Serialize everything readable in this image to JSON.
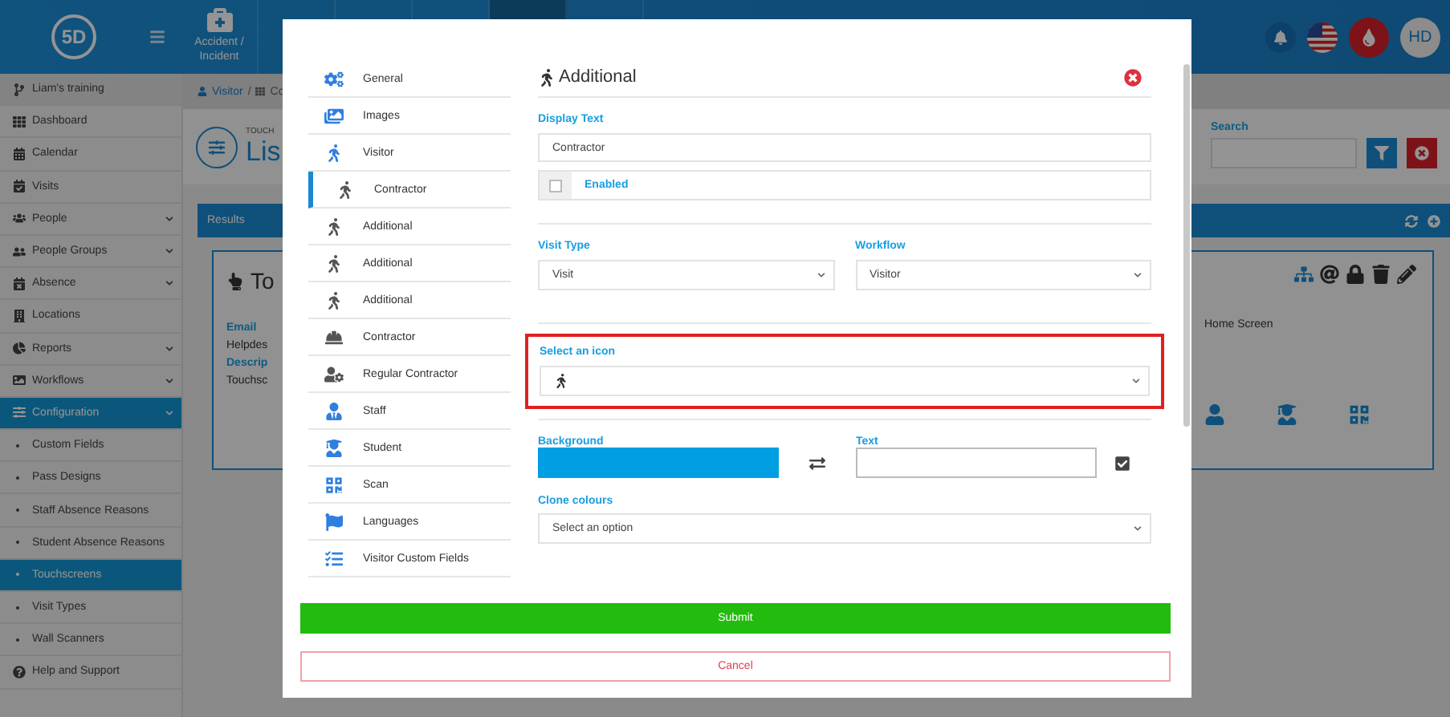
{
  "topbar": {
    "logo": "5D",
    "nav": [
      {
        "label": "Accident / Incident"
      }
    ],
    "avatar": "HD"
  },
  "sidebar": {
    "header": "Liam's training",
    "items": [
      {
        "label": "Dashboard",
        "kind": "main",
        "expandable": false,
        "selected": false
      },
      {
        "label": "Calendar",
        "kind": "main",
        "expandable": false,
        "selected": false
      },
      {
        "label": "Visits",
        "kind": "main",
        "expandable": false,
        "selected": false
      },
      {
        "label": "People",
        "kind": "main",
        "expandable": true,
        "selected": false
      },
      {
        "label": "People Groups",
        "kind": "main",
        "expandable": true,
        "selected": false
      },
      {
        "label": "Absence",
        "kind": "main",
        "expandable": true,
        "selected": false
      },
      {
        "label": "Locations",
        "kind": "main",
        "expandable": false,
        "selected": false
      },
      {
        "label": "Reports",
        "kind": "main",
        "expandable": true,
        "selected": false
      },
      {
        "label": "Workflows",
        "kind": "main",
        "expandable": true,
        "selected": false
      },
      {
        "label": "Configuration",
        "kind": "main",
        "expandable": true,
        "selected": true
      },
      {
        "label": "Custom Fields",
        "kind": "sub",
        "expandable": false,
        "selected": false
      },
      {
        "label": "Pass Designs",
        "kind": "sub",
        "expandable": false,
        "selected": false
      },
      {
        "label": "Staff Absence Reasons",
        "kind": "sub",
        "expandable": false,
        "selected": false
      },
      {
        "label": "Student Absence Reasons",
        "kind": "sub",
        "expandable": false,
        "selected": false
      },
      {
        "label": "Touchscreens",
        "kind": "sub",
        "expandable": false,
        "selected": true
      },
      {
        "label": "Visit Types",
        "kind": "sub",
        "expandable": false,
        "selected": false
      },
      {
        "label": "Wall Scanners",
        "kind": "sub",
        "expandable": false,
        "selected": false
      },
      {
        "label": "Help and Support",
        "kind": "main",
        "expandable": false,
        "selected": false
      }
    ]
  },
  "breadcrumb": {
    "items": [
      "Visitor",
      "Co"
    ],
    "separator": "/"
  },
  "page_header": {
    "caption": "TOUCH",
    "title": "Lis"
  },
  "results": {
    "title": "Results"
  },
  "card": {
    "title": "To",
    "fields": [
      {
        "label": "Email",
        "value": "Helpdes"
      },
      {
        "label": "Descrip",
        "value": "Touchsc"
      }
    ],
    "right_text": "Home Screen"
  },
  "search": {
    "label": "Search"
  },
  "modal": {
    "nav": [
      {
        "label": "General",
        "selected": false,
        "color": "#2f7fe0"
      },
      {
        "label": "Images",
        "selected": false,
        "color": "#2f7fe0"
      },
      {
        "label": "Visitor",
        "selected": false,
        "color": "#2f7fe0"
      },
      {
        "label": "Contractor",
        "selected": true,
        "color": "#555555"
      },
      {
        "label": "Additional",
        "selected": false,
        "color": "#555555"
      },
      {
        "label": "Additional",
        "selected": false,
        "color": "#555555"
      },
      {
        "label": "Additional",
        "selected": false,
        "color": "#555555"
      },
      {
        "label": "Contractor",
        "selected": false,
        "color": "#555555"
      },
      {
        "label": "Regular Contractor",
        "selected": false,
        "color": "#555555"
      },
      {
        "label": "Staff",
        "selected": false,
        "color": "#2f7fe0"
      },
      {
        "label": "Student",
        "selected": false,
        "color": "#2f7fe0"
      },
      {
        "label": "Scan",
        "selected": false,
        "color": "#2f7fe0"
      },
      {
        "label": "Languages",
        "selected": false,
        "color": "#2f7fe0"
      },
      {
        "label": "Visitor Custom Fields",
        "selected": false,
        "color": "#2f7fe0"
      }
    ],
    "title": "Additional",
    "display_text": {
      "label": "Display Text",
      "value": "Contractor"
    },
    "enabled": {
      "label": "Enabled",
      "checked": false
    },
    "visit_type": {
      "label": "Visit Type",
      "value": "Visit"
    },
    "workflow": {
      "label": "Workflow",
      "value": "Visitor"
    },
    "icon_select": {
      "label": "Select an icon",
      "highlighted": true
    },
    "background": {
      "label": "Background",
      "color": "#009ee3"
    },
    "text_colour": {
      "label": "Text"
    },
    "clone": {
      "label": "Clone colours",
      "placeholder": "Select an option"
    },
    "submit": "Submit",
    "cancel": "Cancel"
  }
}
